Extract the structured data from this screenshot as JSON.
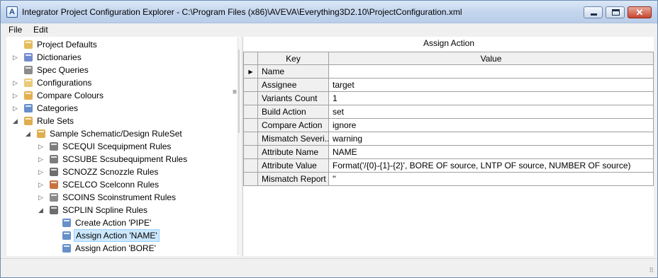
{
  "window": {
    "title": "Integrator Project Configuration Explorer - C:\\Program Files (x86)\\AVEVA\\Everything3D2.10\\ProjectConfiguration.xml",
    "app_icon_letter": "A",
    "close_glyph": "✕"
  },
  "menu": {
    "file": "File",
    "edit": "Edit"
  },
  "tree": {
    "items": [
      {
        "label": "Project Defaults",
        "icon": "pencil-icon",
        "expander": ""
      },
      {
        "label": "Dictionaries",
        "icon": "book-icon",
        "expander": "▷"
      },
      {
        "label": "Spec Queries",
        "icon": "spec-icon",
        "expander": ""
      },
      {
        "label": "Configurations",
        "icon": "folder-icon",
        "expander": "▷"
      },
      {
        "label": "Compare Colours",
        "icon": "palette-icon",
        "expander": "▷"
      },
      {
        "label": "Categories",
        "icon": "categories-icon",
        "expander": "▷"
      },
      {
        "label": "Rule Sets",
        "icon": "ruleset-icon",
        "expander": "◢"
      },
      {
        "label": "Sample Schematic/Design RuleSet",
        "icon": "ruleset-icon",
        "expander": "◢"
      },
      {
        "label": "SCEQUI Scequipment Rules",
        "icon": "equipment-icon",
        "expander": "▷"
      },
      {
        "label": "SCSUBE Scsubequipment Rules",
        "icon": "subequipment-icon",
        "expander": "▷"
      },
      {
        "label": "SCNOZZ Scnozzle Rules",
        "icon": "nozzle-icon",
        "expander": "▷"
      },
      {
        "label": "SCELCO Scelconn Rules",
        "icon": "elconn-icon",
        "expander": "▷"
      },
      {
        "label": "SCOINS Scoinstrument Rules",
        "icon": "instrument-icon",
        "expander": "▷"
      },
      {
        "label": "SCPLIN Scpline Rules",
        "icon": "pipeline-icon",
        "expander": "◢"
      },
      {
        "label": "Create Action 'PIPE'",
        "icon": "create-action-icon",
        "expander": ""
      },
      {
        "label": "Assign Action 'NAME'",
        "icon": "assign-action-icon",
        "expander": "",
        "selected": true
      },
      {
        "label": "Assign Action 'BORE'",
        "icon": "assign-action-icon",
        "expander": ""
      }
    ],
    "scroll_up": "▲",
    "scroll_down": "▼"
  },
  "splitter_grip": "≡",
  "grid": {
    "caption": "Assign Action",
    "headers": {
      "key": "Key",
      "value": "Value"
    },
    "current_row_marker": "▶",
    "rows": [
      {
        "key": "Name",
        "value": ""
      },
      {
        "key": "Assignee",
        "value": "target"
      },
      {
        "key": "Variants Count",
        "value": "1"
      },
      {
        "key": "Build Action",
        "value": "set"
      },
      {
        "key": "Compare Action",
        "value": "ignore"
      },
      {
        "key": "Mismatch Severi...",
        "value": "warning"
      },
      {
        "key": "Attribute Name",
        "value": "NAME"
      },
      {
        "key": "Attribute Value",
        "value": "Format('/{0}-{1}-{2}', BORE OF source, LNTP OF source, NUMBER OF source)"
      },
      {
        "key": "Mismatch Report",
        "value": "''"
      }
    ]
  },
  "status": {
    "grip": "⠿"
  }
}
